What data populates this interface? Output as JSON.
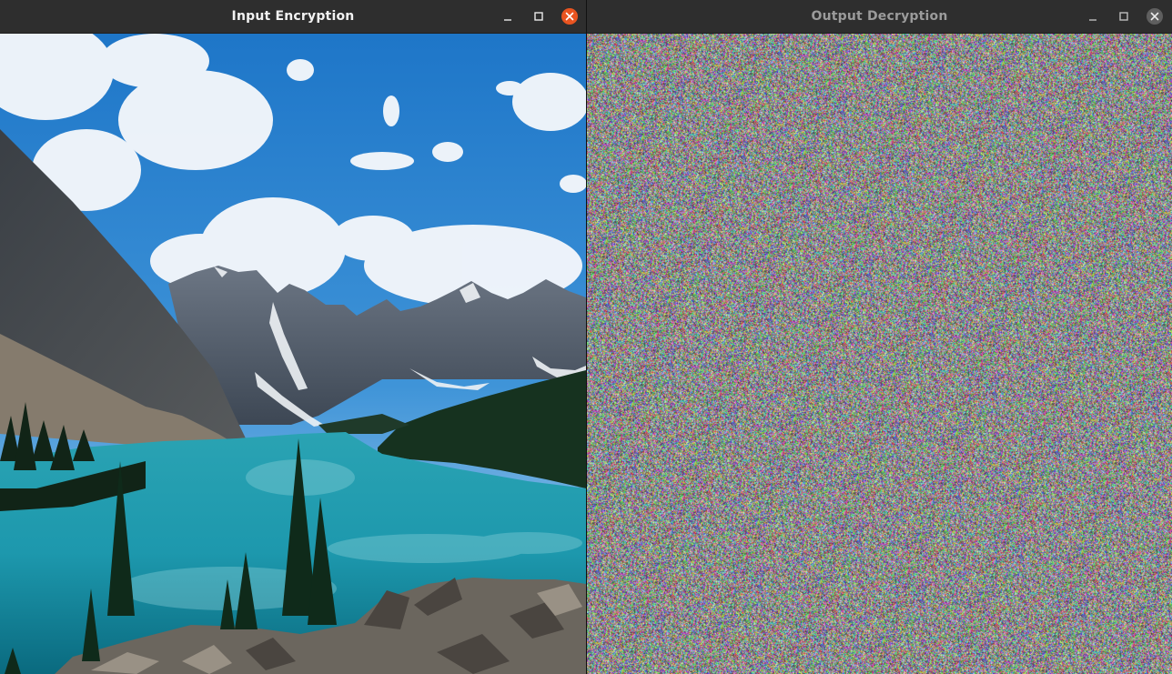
{
  "windows": {
    "left": {
      "title": "Input Encryption",
      "active": true,
      "content": "landscape-photo",
      "buttons": [
        "minimize",
        "maximize",
        "close"
      ],
      "close_color": "#e95420"
    },
    "right": {
      "title": "Output Decryption",
      "active": false,
      "content": "pixel-noise",
      "buttons": [
        "minimize",
        "maximize",
        "close"
      ],
      "close_color": "#5f5f5f"
    }
  },
  "colors": {
    "titlebar": "#2e2e2e",
    "title_active": "#f2f2f2",
    "title_inactive": "#9b9b9b",
    "accent_close": "#e95420"
  }
}
